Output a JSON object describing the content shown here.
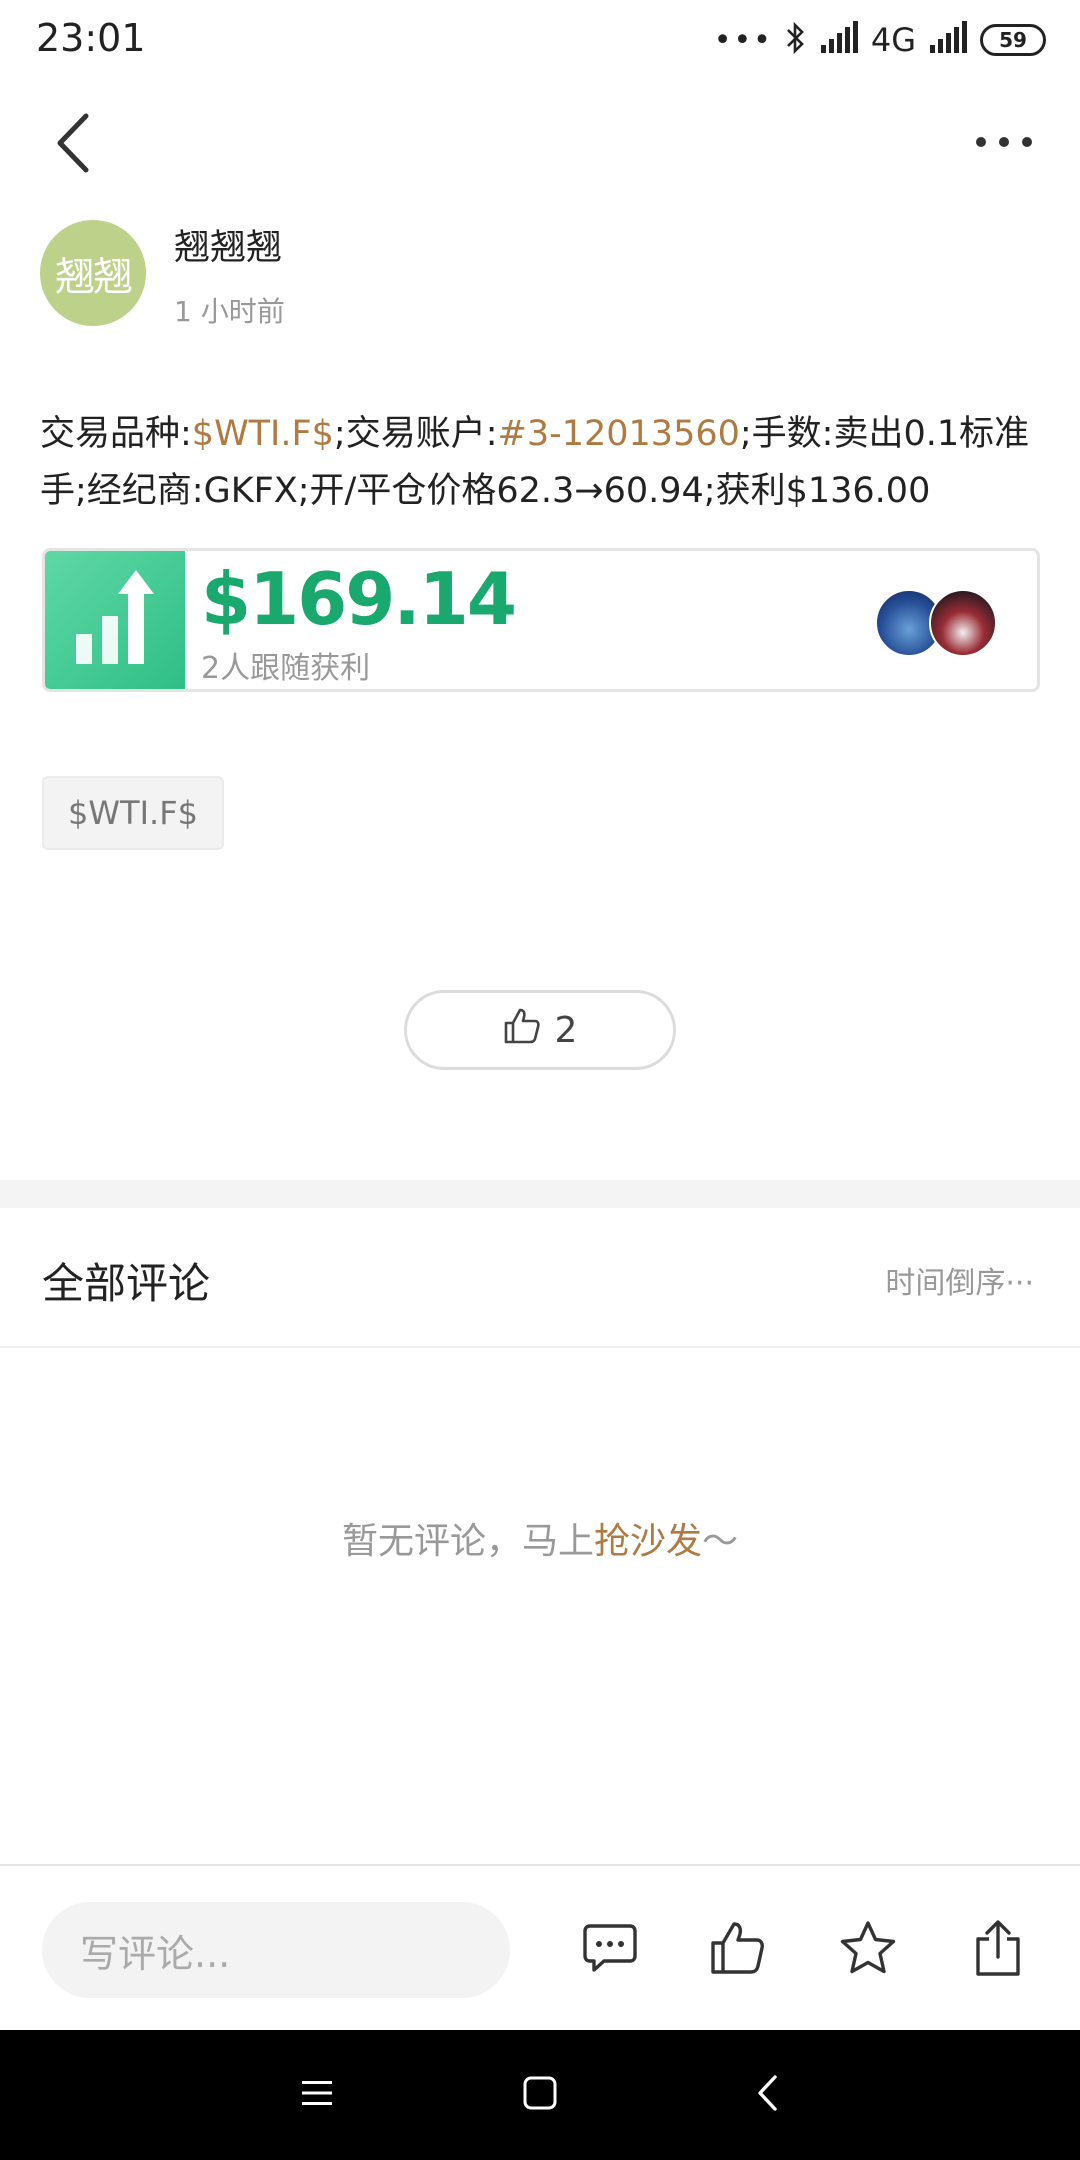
{
  "status_bar": {
    "time": "23:01",
    "dots": "•••",
    "network": "4G",
    "battery": "59"
  },
  "author": {
    "avatar_text": "翘翘",
    "name": "翘翘翘",
    "time_ago": "1 小时前"
  },
  "post": {
    "part1": "交易品种:",
    "symbol_link": "$WTI.F$",
    "part2": ";交易账户:",
    "account_link": "#3-12013560",
    "part3": ";手数:卖出0.1标准手;经纪商:GKFX;开/平仓价格62.3→60.94;获利$136.00"
  },
  "profit_card": {
    "amount": "$169.14",
    "followers_text": "2人跟随获利"
  },
  "tag": "$WTI.F$",
  "like": {
    "count": "2"
  },
  "comments": {
    "title": "全部评论",
    "sort_label": "时间倒序",
    "sort_more": "···",
    "empty_prefix": "暂无评论，马上",
    "empty_link": "抢沙发",
    "empty_suffix": "～"
  },
  "bottom_bar": {
    "input_placeholder": "写评论..."
  },
  "icons": {
    "back": "back-icon",
    "more": "more-icon",
    "bluetooth": "bluetooth-icon",
    "signal": "signal-icon",
    "battery": "battery-icon",
    "profit": "bar-chart-up-icon",
    "thumb": "thumbs-up-icon",
    "comment": "comment-icon",
    "star": "star-icon",
    "share": "share-icon",
    "menu": "menu-icon",
    "home": "home-icon",
    "nav_back": "nav-back-icon"
  },
  "colors": {
    "link": "#b07a42",
    "profit_green": "#19a86e",
    "avatar_bg": "#bdd18a",
    "muted": "#999999"
  }
}
